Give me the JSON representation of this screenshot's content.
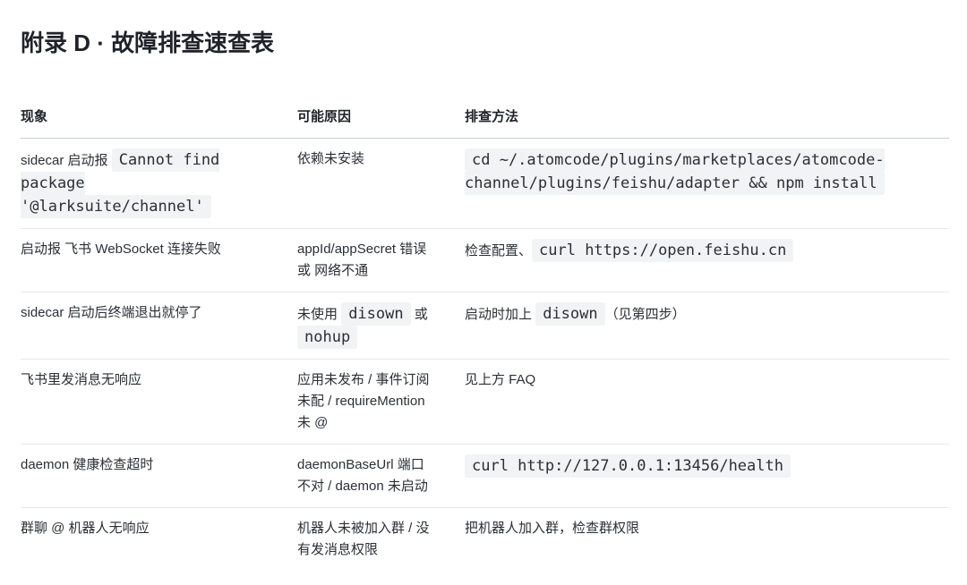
{
  "document": {
    "title": "附录 D · 故障排查速查表"
  },
  "table": {
    "headers": {
      "symptom": "现象",
      "cause": "可能原因",
      "fix": "排查方法"
    },
    "rows": [
      {
        "symptom": [
          {
            "text": "sidecar 启动报"
          },
          {
            "code": "Cannot find package '@larksuite/channel'"
          }
        ],
        "cause": [
          {
            "text": "依赖未安装"
          }
        ],
        "fix": [
          {
            "code": "cd ~/.atomcode/plugins/marketplaces/atomcode-channel/plugins/feishu/adapter && npm install"
          }
        ]
      },
      {
        "symptom": [
          {
            "text": "启动报 飞书 WebSocket 连接失败"
          }
        ],
        "cause": [
          {
            "text": "appId/appSecret 错误或 网络不通"
          }
        ],
        "fix": [
          {
            "text": "检查配置、"
          },
          {
            "code": "curl https://open.feishu.cn"
          }
        ]
      },
      {
        "symptom": [
          {
            "text": "sidecar 启动后终端退出就停了"
          }
        ],
        "cause": [
          {
            "text": "未使用"
          },
          {
            "code": "disown"
          },
          {
            "text": "或"
          },
          {
            "code": "nohup"
          }
        ],
        "fix": [
          {
            "text": "启动时加上"
          },
          {
            "code": "disown"
          },
          {
            "text": "（见第四步）"
          }
        ]
      },
      {
        "symptom": [
          {
            "text": "飞书里发消息无响应"
          }
        ],
        "cause": [
          {
            "text": "应用未发布 / 事件订阅未配 / requireMention 未 @"
          }
        ],
        "fix": [
          {
            "text": "见上方 FAQ"
          }
        ]
      },
      {
        "symptom": [
          {
            "text": "daemon 健康检查超时"
          }
        ],
        "cause": [
          {
            "text": "daemonBaseUrl 端口不对 / daemon 未启动"
          }
        ],
        "fix": [
          {
            "code": "curl http://127.0.0.1:13456/health"
          }
        ]
      },
      {
        "symptom": [
          {
            "text": "群聊 @ 机器人无响应"
          }
        ],
        "cause": [
          {
            "text": "机器人未被加入群 / 没有发消息权限"
          }
        ],
        "fix": [
          {
            "text": "把机器人加入群，检查群权限"
          }
        ]
      }
    ]
  }
}
